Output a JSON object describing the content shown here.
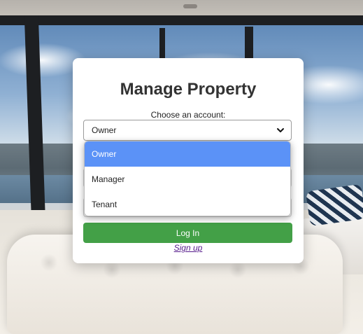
{
  "page": {
    "title": "Manage Property",
    "account_label": "Choose an account:"
  },
  "account_select": {
    "selected": "Owner",
    "options": [
      "Owner",
      "Manager",
      "Tenant"
    ]
  },
  "actions": {
    "login_label": "Log In",
    "signup_label": "Sign up"
  },
  "colors": {
    "accent_selected": "#5b92f7",
    "login_button": "#43a047",
    "signup_link": "#551a8b"
  },
  "icons": {
    "select_indicator": "chevron-down-icon"
  }
}
